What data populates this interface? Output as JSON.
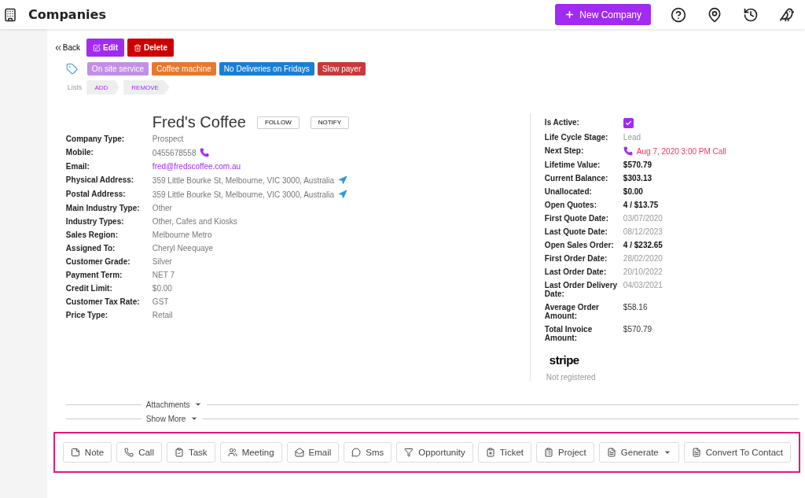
{
  "header": {
    "title": "Companies",
    "new_button": "New Company"
  },
  "toolbar": {
    "back": "Back",
    "edit": "Edit",
    "delete": "Delete"
  },
  "tags": [
    {
      "label": "On site service",
      "color": "#c28fe6"
    },
    {
      "label": "Coffee machine",
      "color": "#e8772e"
    },
    {
      "label": "No Deliveries on Fridays",
      "color": "#1a7fd4"
    },
    {
      "label": "Slow payer",
      "color": "#c9393a"
    }
  ],
  "lists": {
    "label": "Lists",
    "add": "ADD",
    "remove": "REMOVE"
  },
  "company": {
    "name": "Fred's Coffee",
    "follow": "FOLLOW",
    "notify": "NOTIFY"
  },
  "details": [
    {
      "label": "Company Type:",
      "value": "Prospect",
      "kind": "text"
    },
    {
      "label": "Mobile:",
      "value": "0455678558",
      "kind": "phone"
    },
    {
      "label": "Email:",
      "value": "fred@fredscoffee.com.au",
      "kind": "link"
    },
    {
      "label": "Physical Address:",
      "value": "359 Little Bourke St, Melbourne, VIC 3000, Australia",
      "kind": "address"
    },
    {
      "label": "Postal Address:",
      "value": "359 Little Bourke St, Melbourne, VIC 3000, Australia",
      "kind": "address"
    },
    {
      "label": "Main Industry Type:",
      "value": "Other",
      "kind": "text"
    },
    {
      "label": "Industry Types:",
      "value": "Other, Cafes and Kiosks",
      "kind": "text"
    },
    {
      "label": "Sales Region:",
      "value": "Melbourne Metro",
      "kind": "text"
    },
    {
      "label": "Assigned To:",
      "value": "Cheryl Neequaye",
      "kind": "text"
    },
    {
      "label": "Customer Grade:",
      "value": "Silver",
      "kind": "text"
    },
    {
      "label": "Payment Term:",
      "value": "NET 7",
      "kind": "text"
    },
    {
      "label": "Credit Limit:",
      "value": "$0.00",
      "kind": "text"
    },
    {
      "label": "Customer Tax Rate:",
      "value": "GST",
      "kind": "text"
    },
    {
      "label": "Price Type:",
      "value": "Retail",
      "kind": "text"
    }
  ],
  "summary": [
    {
      "label": "Is Active:",
      "kind": "checkbox",
      "checked": true
    },
    {
      "label": "Life Cycle Stage:",
      "value": "Lead",
      "kind": "muted"
    },
    {
      "label": "Next Step:",
      "value": "Aug 7, 2020 3:00 PM Call",
      "kind": "step"
    },
    {
      "label": "Lifetime Value:",
      "value": "$570.79",
      "kind": "bold"
    },
    {
      "label": "Current Balance:",
      "value": "$303.13",
      "kind": "bold"
    },
    {
      "label": "Unallocated:",
      "value": "$0.00",
      "kind": "bold"
    },
    {
      "label": "Open Quotes:",
      "value": "4 / $13.75",
      "kind": "bold"
    },
    {
      "label": "First Quote Date:",
      "value": "03/07/2020",
      "kind": "muted"
    },
    {
      "label": "Last Quote Date:",
      "value": "08/12/2023",
      "kind": "muted"
    },
    {
      "label": "Open Sales Order:",
      "value": "4 / $232.65",
      "kind": "bold"
    },
    {
      "label": "First Order Date:",
      "value": "28/02/2020",
      "kind": "muted"
    },
    {
      "label": "Last Order Date:",
      "value": "20/10/2022",
      "kind": "muted"
    },
    {
      "label": "Last Order Delivery Date:",
      "value": "04/03/2021",
      "kind": "muted"
    },
    {
      "label": "Average Order Amount:",
      "value": "$58.16",
      "kind": "plain"
    },
    {
      "label": "Total Invoice Amount:",
      "value": "$570.79",
      "kind": "plain"
    }
  ],
  "stripe": {
    "logo": "stripe",
    "status": "Not registered"
  },
  "sections": [
    "Attachments",
    "Show More"
  ],
  "actions": [
    {
      "label": "Note",
      "dropdown": false
    },
    {
      "label": "Call",
      "dropdown": false
    },
    {
      "label": "Task",
      "dropdown": false
    },
    {
      "label": "Meeting",
      "dropdown": false
    },
    {
      "label": "Email",
      "dropdown": false
    },
    {
      "label": "Sms",
      "dropdown": false
    },
    {
      "label": "Opportunity",
      "dropdown": false
    },
    {
      "label": "Ticket",
      "dropdown": false
    },
    {
      "label": "Project",
      "dropdown": false
    },
    {
      "label": "Generate",
      "dropdown": true
    },
    {
      "label": "Convert To Contact",
      "dropdown": false
    }
  ]
}
